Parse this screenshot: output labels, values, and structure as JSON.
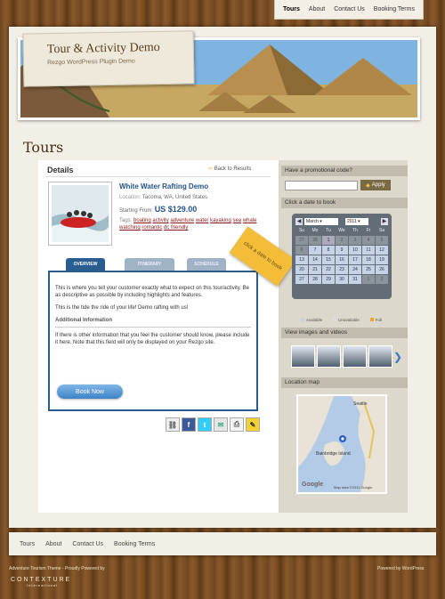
{
  "top_nav": [
    "Tours",
    "About",
    "Contact Us",
    "Booking Terms"
  ],
  "site": {
    "title": "Tour & Activity Demo",
    "tagline": "Rezgo WordPress Plugin Demo"
  },
  "page_title": "Tours",
  "details": {
    "heading": "Details",
    "back_link": "Back to Results",
    "tour_name": "White Water Rafting Demo",
    "location_label": "Location:",
    "location": "Tacoma, WA, United States",
    "starting_label": "Starting From:",
    "price": "US $129.00",
    "tags_label": "Tags:",
    "tags": [
      "boating",
      "activity",
      "adventure",
      "water",
      "kayaking",
      "sea",
      "whale watching",
      "romantic",
      "dc friendly"
    ]
  },
  "tabs": [
    "OVERVIEW",
    "ITINERARY",
    "SCHEDULE"
  ],
  "overview": {
    "p1": "This is where you tell your customer exactly what to expect on this tour/activity. Be as descriptive as possible by including highlights and features.",
    "p2": "This is the tide the ride of your life! Demo rafting with us!",
    "additional_heading": "Additional Information",
    "p3": "If there is other information that you feel the customer should know, please include it here. Note that this field will only be displayed on your Rezgo site.",
    "book_button": "Book Now"
  },
  "sticky_note": "click a date to book",
  "sidebar": {
    "promo_heading": "Have a promotional code?",
    "apply_label": "Apply",
    "date_heading": "Click a date to book",
    "month": "March",
    "year": "2011",
    "weekdays": [
      "Su",
      "Mo",
      "Tu",
      "We",
      "Th",
      "Fr",
      "Sa"
    ],
    "days": [
      {
        "n": "27",
        "s": "na"
      },
      {
        "n": "28",
        "s": "na"
      },
      {
        "n": "1",
        "s": "sel"
      },
      {
        "n": "2",
        "s": "na"
      },
      {
        "n": "3",
        "s": "na"
      },
      {
        "n": "4",
        "s": "na"
      },
      {
        "n": "5",
        "s": "na"
      },
      {
        "n": "6",
        "s": "na"
      },
      {
        "n": "7",
        "s": "av"
      },
      {
        "n": "8",
        "s": "av"
      },
      {
        "n": "9",
        "s": "av"
      },
      {
        "n": "10",
        "s": "av"
      },
      {
        "n": "11",
        "s": "av"
      },
      {
        "n": "12",
        "s": "av"
      },
      {
        "n": "13",
        "s": "av"
      },
      {
        "n": "14",
        "s": "av"
      },
      {
        "n": "15",
        "s": "av"
      },
      {
        "n": "16",
        "s": "av"
      },
      {
        "n": "17",
        "s": "av"
      },
      {
        "n": "18",
        "s": "av"
      },
      {
        "n": "19",
        "s": "av"
      },
      {
        "n": "20",
        "s": "av"
      },
      {
        "n": "21",
        "s": "av"
      },
      {
        "n": "22",
        "s": "av"
      },
      {
        "n": "23",
        "s": "av"
      },
      {
        "n": "24",
        "s": "av"
      },
      {
        "n": "25",
        "s": "av"
      },
      {
        "n": "26",
        "s": "av"
      },
      {
        "n": "27",
        "s": "av"
      },
      {
        "n": "28",
        "s": "av"
      },
      {
        "n": "29",
        "s": "av"
      },
      {
        "n": "30",
        "s": "av"
      },
      {
        "n": "31",
        "s": "av"
      },
      {
        "n": "1",
        "s": "na"
      },
      {
        "n": "2",
        "s": "na"
      }
    ],
    "legend": [
      "Available",
      "Unavailable",
      "Full"
    ],
    "images_heading": "View images and videos",
    "map_heading": "Location map",
    "map_labels": [
      "Bainbridge Island",
      "Seattle",
      "Google",
      "Map data ©2011 Google"
    ]
  },
  "bottom_nav": [
    "Tours",
    "About",
    "Contact Us",
    "Booking Terms"
  ],
  "footer": {
    "left": "Adventure Tourism Theme - Proudly Powered by",
    "right": "Powered by WordPress",
    "logo": "CONTEXTURE",
    "logo_sub": "International"
  },
  "colors": {
    "accent": "#23548c",
    "tab": "#2a5d8f",
    "sticky": "#f3bd3a"
  }
}
